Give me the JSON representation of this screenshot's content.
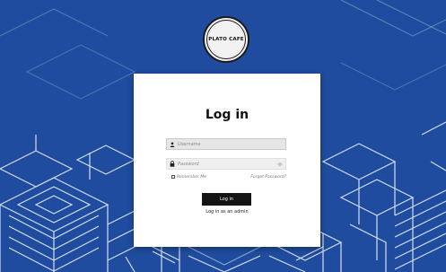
{
  "brand": {
    "logo_text": "PLATO CAFE"
  },
  "login": {
    "title": "Log in",
    "username_placeholder": "Username",
    "password_placeholder": "Password",
    "remember_label": "Remember Me",
    "forgot_label": "Forgot Password?",
    "button_label": "Log in",
    "admin_link": "Log in as an admin"
  },
  "icons": {
    "username": "user-icon",
    "password": "lock-icon",
    "toggle": "eye-icon"
  },
  "colors": {
    "background": "#1f4c9e",
    "pattern": "#dfe6f2",
    "card": "#ffffff",
    "button": "#141414"
  }
}
